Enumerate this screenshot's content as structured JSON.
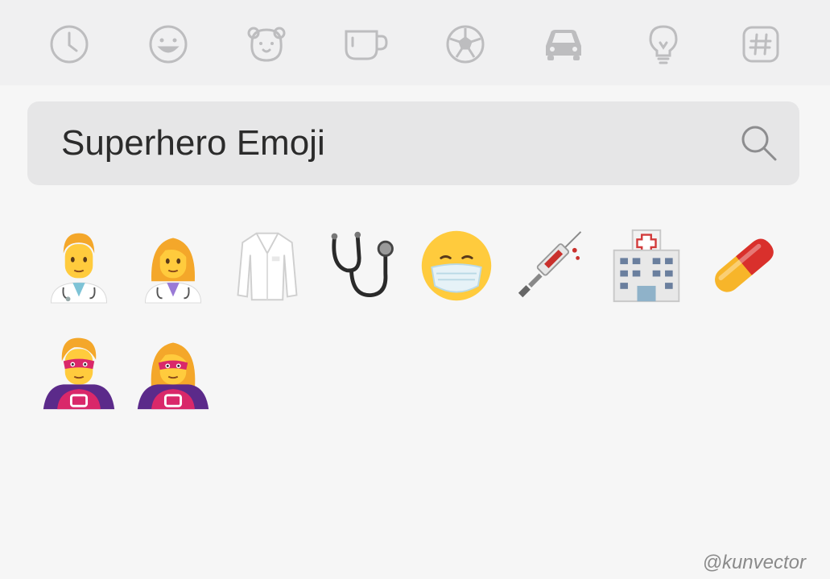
{
  "category_bar": {
    "icons": [
      "recent-icon",
      "smileys-icon",
      "animals-icon",
      "food-icon",
      "activity-icon",
      "travel-icon",
      "objects-icon",
      "symbols-icon"
    ],
    "icon_color": "#bdbdbf"
  },
  "search": {
    "query": "Superhero Emoji",
    "icon": "search-icon"
  },
  "results": [
    "man-health-worker-emoji",
    "woman-health-worker-emoji",
    "lab-coat-emoji",
    "stethoscope-emoji",
    "face-with-medical-mask-emoji",
    "syringe-emoji",
    "hospital-emoji",
    "pill-emoji",
    "man-superhero-emoji",
    "woman-superhero-emoji"
  ],
  "credit": "@kunvector",
  "colors": {
    "background": "#f6f6f6",
    "category_bar": "#f0f0f1",
    "search_field": "#e6e6e7",
    "text": "#2b2b2b"
  }
}
